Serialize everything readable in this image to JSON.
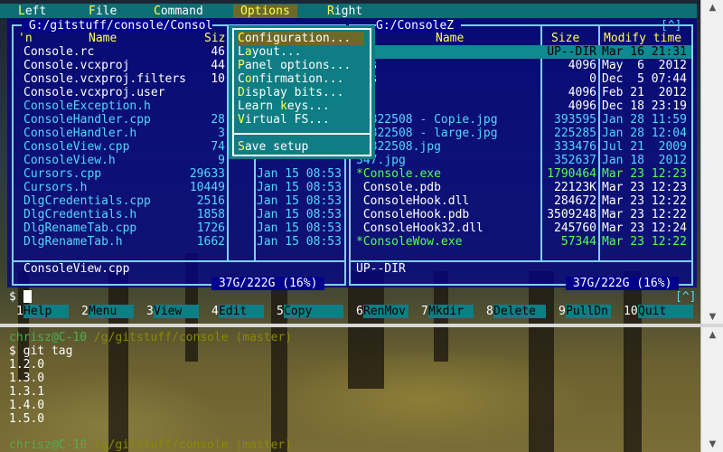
{
  "menubar": {
    "items": [
      {
        "label": "Left",
        "hot": "L",
        "rest": "eft"
      },
      {
        "label": "File",
        "hot": "F",
        "rest": "ile"
      },
      {
        "label": "Command",
        "hot": "C",
        "rest": "ommand"
      },
      {
        "label": "Options",
        "hot": "O",
        "rest": "ptions"
      },
      {
        "label": "Right",
        "hot": "R",
        "rest": "ight"
      }
    ]
  },
  "left_panel": {
    "path": " G:/gitstuff/console/Consol",
    "col_n": "'n",
    "col_name": "Name",
    "col_size": "Siz",
    "rows": [
      {
        "name": "Console.rc",
        "size": "46",
        "date": "",
        "cls": "fw"
      },
      {
        "name": "Console.vcxproj",
        "size": "44",
        "date": "",
        "cls": "fw"
      },
      {
        "name": "Console.vcxproj.filters",
        "size": "10",
        "date": "",
        "cls": "fw"
      },
      {
        "name": "Console.vcxproj.user",
        "size": "",
        "date": "",
        "cls": "fw"
      },
      {
        "name": "ConsoleException.h",
        "size": "",
        "date": "",
        "cls": "fc"
      },
      {
        "name": "ConsoleHandler.cpp",
        "size": "28",
        "date": "",
        "cls": "fc"
      },
      {
        "name": "ConsoleHandler.h",
        "size": "3",
        "date": "",
        "cls": "fc"
      },
      {
        "name": "ConsoleView.cpp",
        "size": "74",
        "date": "",
        "cls": "fc"
      },
      {
        "name": "ConsoleView.h",
        "size": "9",
        "date": "",
        "cls": "fc"
      },
      {
        "name": "Cursors.cpp",
        "size": "29633",
        "date": "Jan 15 08:53",
        "cls": "fc"
      },
      {
        "name": "Cursors.h",
        "size": "10449",
        "date": "Jan 15 08:53",
        "cls": "fc"
      },
      {
        "name": "DlgCredentials.cpp",
        "size": "2516",
        "date": "Jan 15 08:53",
        "cls": "fc"
      },
      {
        "name": "DlgCredentials.h",
        "size": "1858",
        "date": "Jan 15 08:53",
        "cls": "fc"
      },
      {
        "name": "DlgRenameTab.cpp",
        "size": "1726",
        "date": "Jan 15 08:53",
        "cls": "fc"
      },
      {
        "name": "DlgRenameTab.h",
        "size": "1662",
        "date": "Jan 15 08:53",
        "cls": "fc"
      }
    ],
    "selected_file": "ConsoleView.cpp",
    "disk_info": " 37G/222G (16%) "
  },
  "right_panel": {
    "path": "G:/ConsoleZ ",
    "scroll_marker": "[^]",
    "col_name": "Name",
    "col_size": "Size",
    "col_modify": "Modify time",
    "rows": [
      {
        "name": "",
        "size": "UP--DIR",
        "date": "Mar 16 21:31",
        "cls": "fw",
        "sel": true
      },
      {
        "name": "nts",
        "size": "4096",
        "date": "May  6  2012",
        "cls": "fw"
      },
      {
        "name": "ons",
        "size": "0",
        "date": "Dec  5 07:44",
        "cls": "fw"
      },
      {
        "name": "h",
        "size": "4096",
        "date": "Feb 21  2012",
        "cls": "fw"
      },
      {
        "name": "b",
        "size": "4096",
        "date": "Dec 18 23:19",
        "cls": "fw"
      },
      {
        "name": "32822508 - Copie.jpg",
        "size": "393595",
        "date": "Jan 28 11:59",
        "cls": "fc"
      },
      {
        "name": "32822508 - large.jpg",
        "size": "225285",
        "date": "Jan 28 12:04",
        "cls": "fc"
      },
      {
        "name": "32822508.jpg",
        "size": "333476",
        "date": "Jul 21  2009",
        "cls": "fc"
      },
      {
        "name": "347.jpg",
        "size": "352637",
        "date": "Jan 18  2012",
        "cls": "fc"
      },
      {
        "name": "*Console.exe",
        "size": "1790464",
        "date": "Mar 23 12:23",
        "cls": "fg"
      },
      {
        "name": " Console.pdb",
        "size": "22123K",
        "date": "Mar 23 12:23",
        "cls": "fw"
      },
      {
        "name": " ConsoleHook.dll",
        "size": "284672",
        "date": "Mar 23 12:22",
        "cls": "fw"
      },
      {
        "name": " ConsoleHook.pdb",
        "size": "3509248",
        "date": "Mar 23 12:22",
        "cls": "fw"
      },
      {
        "name": " ConsoleHook32.dll",
        "size": "245760",
        "date": "Mar 23 12:24",
        "cls": "fw"
      },
      {
        "name": "*ConsoleWow.exe",
        "size": "57344",
        "date": "Mar 23 12:22",
        "cls": "fg"
      }
    ],
    "selected_file": "UP--DIR",
    "disk_info": " 37G/222G (16%) "
  },
  "options_menu": {
    "items": [
      {
        "hot": "C",
        "rest": "onfiguration...",
        "selected": true
      },
      {
        "pre": "L",
        "hot": "a",
        "rest": "yout..."
      },
      {
        "hot": "P",
        "rest": "anel options..."
      },
      {
        "pre": "C",
        "hot": "o",
        "rest": "nfirmation..."
      },
      {
        "hot": "D",
        "rest": "isplay bits..."
      },
      {
        "pre": "Learn ",
        "hot": "k",
        "rest": "eys..."
      },
      {
        "hot": "V",
        "rest": "irtual FS..."
      },
      {
        "hot": "S",
        "rest": "ave setup"
      }
    ]
  },
  "command_line": {
    "prompt": "$",
    "scroll_marker": "[^]"
  },
  "keybar": [
    {
      "num": "1",
      "label": "Help"
    },
    {
      "num": "2",
      "label": "Menu"
    },
    {
      "num": "3",
      "label": "View"
    },
    {
      "num": "4",
      "label": "Edit"
    },
    {
      "num": "5",
      "label": "Copy"
    },
    {
      "num": "6",
      "label": "RenMov"
    },
    {
      "num": "7",
      "label": "Mkdir"
    },
    {
      "num": "8",
      "label": "Delete"
    },
    {
      "num": "9",
      "label": "PullDn"
    },
    {
      "num": "10",
      "label": "Quit"
    }
  ],
  "lower_console": {
    "prompt_user": "chrisz@C-10",
    "prompt_path": "/g/gitstuff/console",
    "prompt_branch": "(master)",
    "command": "$ git tag",
    "output": [
      "1.2.0",
      "1.3.0",
      "1.3.1",
      "1.4.0",
      "1.5.0"
    ]
  },
  "colors": {
    "panel_bg": "#00008c",
    "menu_bg": "#0f7e84",
    "hotkey": "#ffff55",
    "frame": "#7fd0ff"
  }
}
